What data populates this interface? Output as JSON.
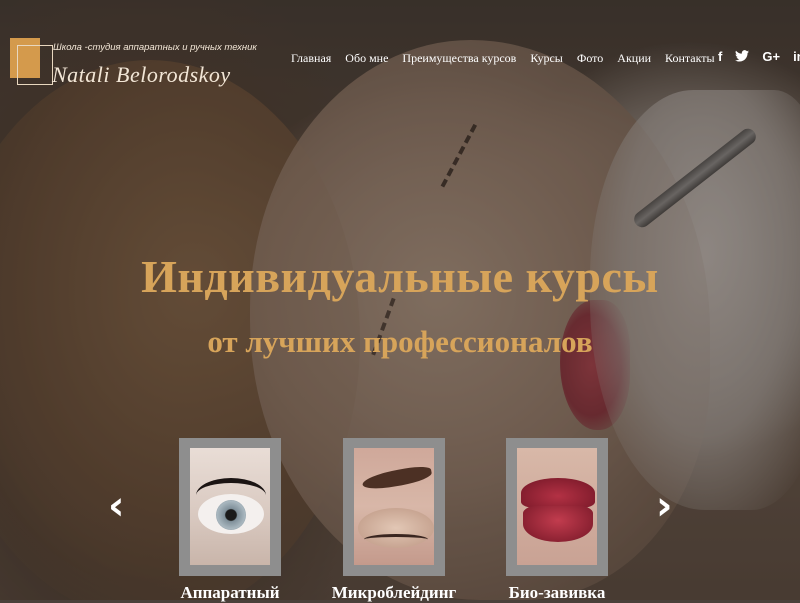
{
  "header": {
    "tagline": "Школа -студия аппаратных и ручных техник",
    "brand_name": "Natali Belorodskoy"
  },
  "nav": {
    "items": [
      "Главная",
      "Обо мне",
      "Преимущества курсов",
      "Курсы",
      "Фото",
      "Акции",
      "Контакты"
    ]
  },
  "social": {
    "icons": [
      {
        "name": "facebook-icon",
        "glyph": "f"
      },
      {
        "name": "twitter-icon",
        "glyph": "🐦"
      },
      {
        "name": "google-plus-icon",
        "glyph": "G+"
      },
      {
        "name": "linkedin-icon",
        "glyph": "in"
      }
    ]
  },
  "hero": {
    "title": "Индивидуальные курсы",
    "subtitle": "от лучших профессионалов"
  },
  "carousel": {
    "prev_glyph": "‹",
    "next_glyph": "›",
    "cards": [
      {
        "label": "Аппаратный",
        "image": "eye-eyelashes"
      },
      {
        "label": "Микроблейдинг",
        "image": "eyebrow"
      },
      {
        "label": "Био-завивка",
        "image": "lips"
      }
    ]
  },
  "colors": {
    "accent_gold": "#d7a45a",
    "logo_orange": "#d49a4c",
    "card_frame": "#8e8e8e"
  }
}
